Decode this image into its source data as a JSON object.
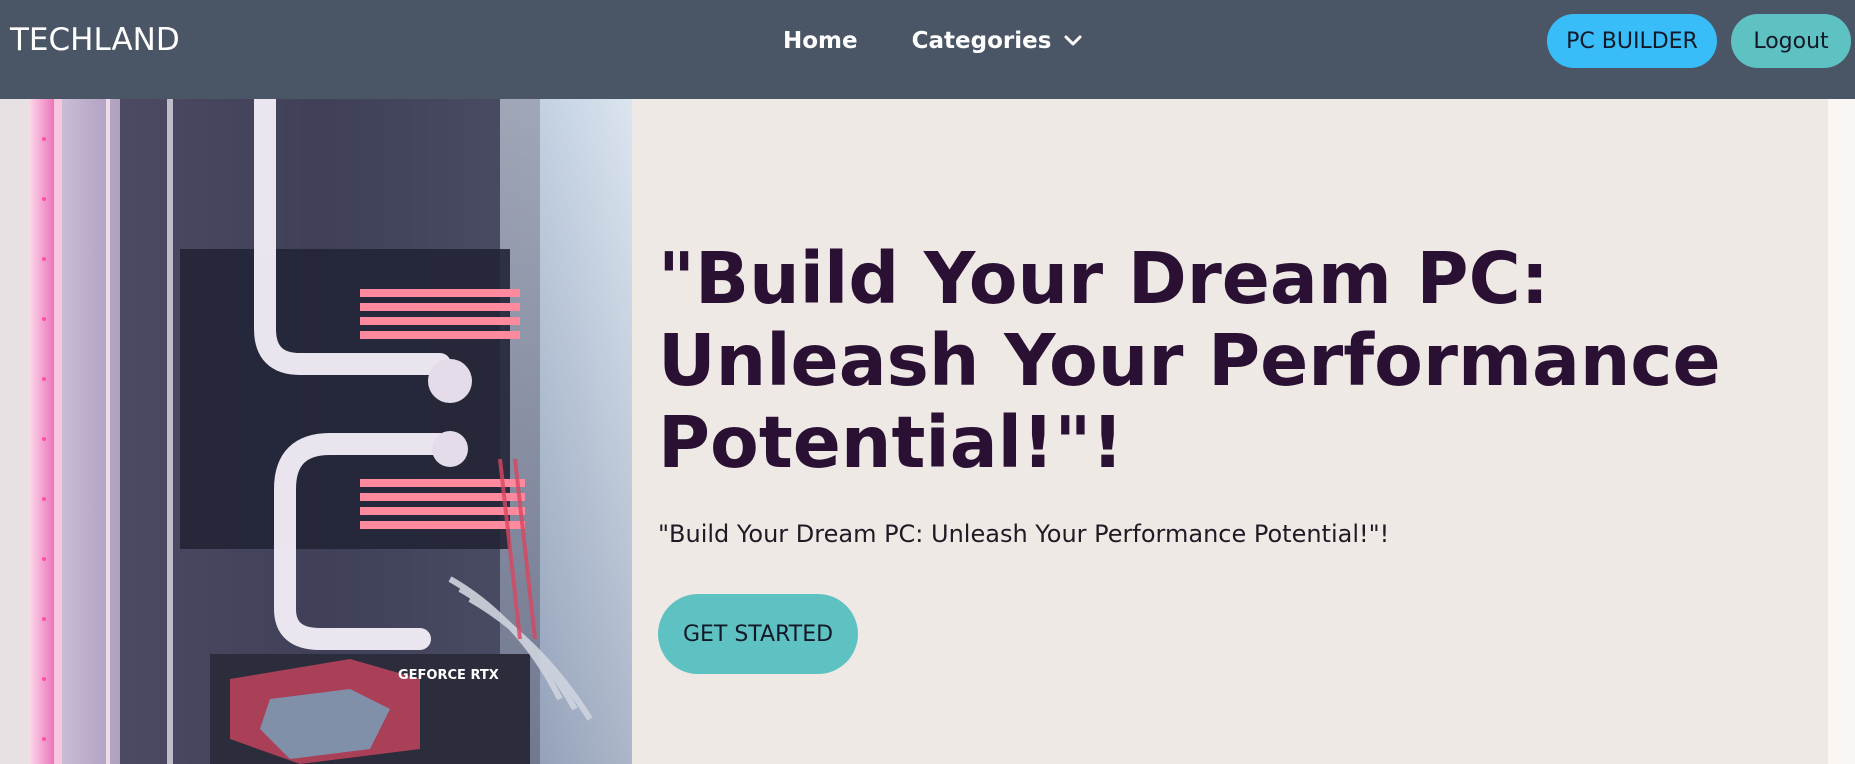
{
  "navbar": {
    "brand": "TECHLAND",
    "links": {
      "home": "Home",
      "categories": "Categories"
    },
    "pc_builder_label": "PC BUILDER",
    "logout_label": "Logout"
  },
  "hero": {
    "title": "\"Build Your Dream PC: Unleash Your Performance Potential!\"!",
    "subtitle": "\"Build Your Dream PC: Unleash Your Performance Potential!\"!",
    "cta_label": "GET STARTED"
  },
  "icons": {
    "categories_dropdown": "chevron-down-icon"
  },
  "colors": {
    "navbar_bg": "#4a5565",
    "pc_builder_bg": "#38bdf8",
    "logout_bg": "#5fc2c2",
    "cta_bg": "#5fc2c2",
    "hero_bg": "#efe9e6",
    "title_color": "#2a1133"
  }
}
